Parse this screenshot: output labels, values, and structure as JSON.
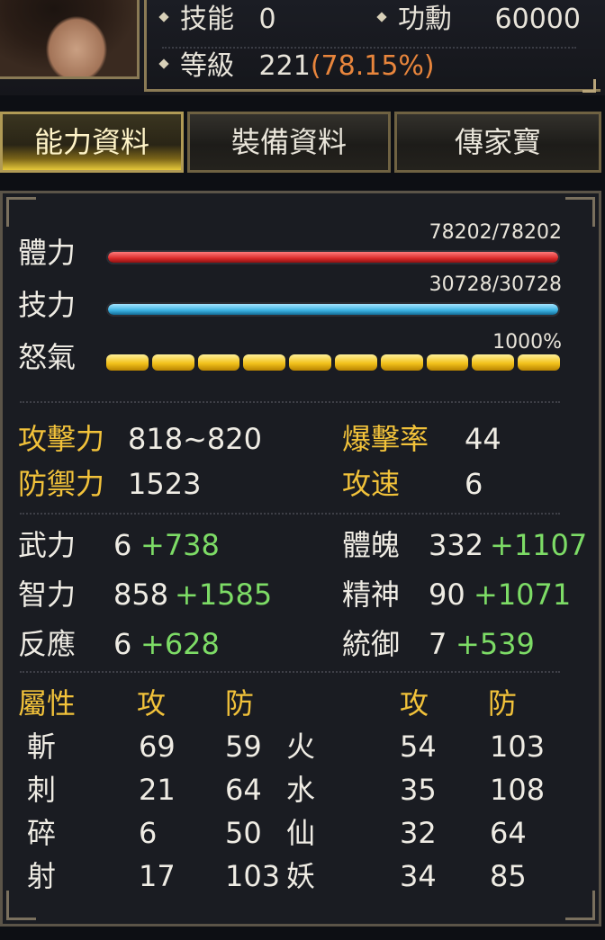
{
  "header": {
    "skill_label": "技能",
    "skill_value": "0",
    "merit_label": "功勳",
    "merit_value": "60000",
    "level_label": "等級",
    "level_value": "221",
    "level_pct": "(78.15%)"
  },
  "tabs": [
    {
      "label": "能力資料",
      "active": true
    },
    {
      "label": "裝備資料",
      "active": false
    },
    {
      "label": "傳家寶",
      "active": false
    }
  ],
  "bars": {
    "hp": {
      "label": "體力",
      "value": "78202/78202",
      "fill": 1.0
    },
    "mp": {
      "label": "技力",
      "value": "30728/30728",
      "fill": 1.0
    },
    "rage": {
      "label": "怒氣",
      "value": "1000%",
      "segments": 10,
      "filled": 10
    }
  },
  "combat": {
    "attack_label": "攻擊力",
    "attack_value": "818~820",
    "crit_label": "爆擊率",
    "crit_value": "44",
    "defense_label": "防禦力",
    "defense_value": "1523",
    "speed_label": "攻速",
    "speed_value": "6"
  },
  "attributes": [
    {
      "label": "武力",
      "base": "6",
      "bonus": "+738"
    },
    {
      "label": "體魄",
      "base": "332",
      "bonus": "+1107"
    },
    {
      "label": "智力",
      "base": "858",
      "bonus": "+1585"
    },
    {
      "label": "精神",
      "base": "90",
      "bonus": "+1071"
    },
    {
      "label": "反應",
      "base": "6",
      "bonus": "+628"
    },
    {
      "label": "統御",
      "base": "7",
      "bonus": "+539"
    }
  ],
  "elements": {
    "header": {
      "title": "屬性",
      "atk": "攻",
      "def": "防",
      "atk2": "攻",
      "def2": "防"
    },
    "rows": [
      {
        "name1": "斬",
        "atk1": "69",
        "def1": "59",
        "name2": "火",
        "atk2": "54",
        "def2": "103"
      },
      {
        "name1": "刺",
        "atk1": "21",
        "def1": "64",
        "name2": "水",
        "atk2": "35",
        "def2": "108"
      },
      {
        "name1": "碎",
        "atk1": "6",
        "def1": "50",
        "name2": "仙",
        "atk2": "32",
        "def2": "64"
      },
      {
        "name1": "射",
        "atk1": "17",
        "def1": "103",
        "name2": "妖",
        "atk2": "34",
        "def2": "85"
      }
    ]
  },
  "colors": {
    "accent_gold": "#f2c23a",
    "bonus_green": "#7ddc66",
    "level_pct": "#e8853c",
    "hp": "#d92b2b",
    "mp": "#3ab0e0"
  }
}
